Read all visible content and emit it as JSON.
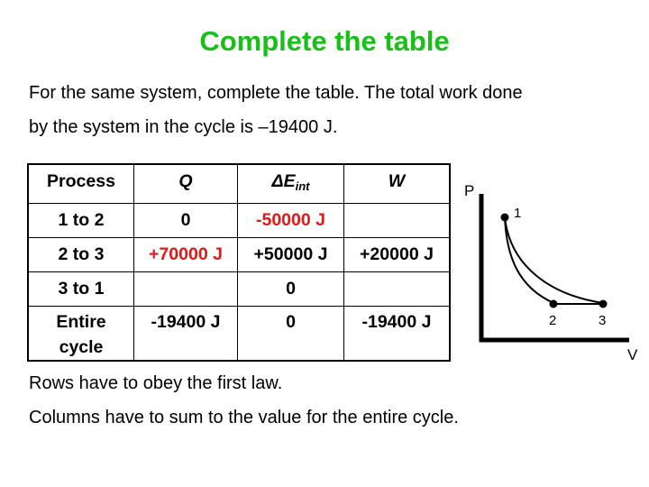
{
  "title": "Complete the table",
  "intro": {
    "line1": "For the same system, complete the table. The total work done",
    "line2": "by the system in the cycle is –19400 J."
  },
  "table": {
    "headers": {
      "process": "Process",
      "q": "Q",
      "delta_e_main": "ΔE",
      "delta_e_sub": "int",
      "w": "W"
    },
    "rows": [
      {
        "process": "1 to 2",
        "q": "0",
        "delta_e": "-50000 J",
        "w": "",
        "highlight": [
          "delta_e"
        ]
      },
      {
        "process": "2 to 3",
        "q": "+70000 J",
        "delta_e": "+50000 J",
        "w": "+20000 J",
        "highlight": [
          "q"
        ]
      },
      {
        "process": "3 to 1",
        "q": "",
        "delta_e": "0",
        "w": ""
      },
      {
        "process_line1": "Entire",
        "process_line2": "cycle",
        "q": "-19400 J",
        "delta_e": "0",
        "w": "-19400 J"
      }
    ],
    "highlight_color": "#e01818"
  },
  "pv_diagram": {
    "axis_labels": {
      "y": "P",
      "x": "V"
    },
    "points": [
      {
        "label": "1"
      },
      {
        "label": "2"
      },
      {
        "label": "3"
      }
    ],
    "processes": [
      {
        "from": "1",
        "to": "2",
        "shape": "curve (steeper, adiabatic)"
      },
      {
        "from": "2",
        "to": "3",
        "shape": "horizontal line (isobaric)"
      },
      {
        "from": "3",
        "to": "1",
        "shape": "curve (isothermal)"
      }
    ]
  },
  "notes": {
    "line1": "Rows have to obey the first law.",
    "line2": "Columns have to sum to the value for the entire cycle."
  },
  "colors": {
    "title": "#17c017",
    "text": "#000000",
    "highlight": "#e01818"
  }
}
